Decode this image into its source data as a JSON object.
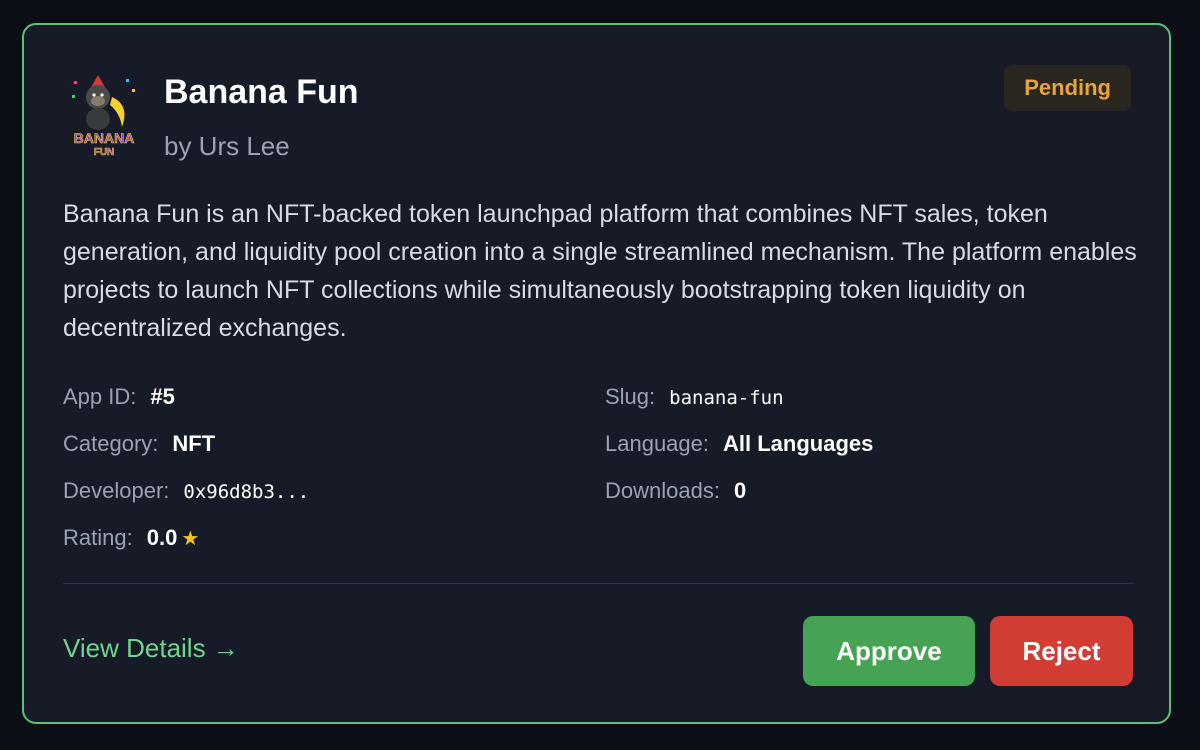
{
  "app": {
    "title": "Banana Fun",
    "author": "by Urs Lee",
    "logo_icon": "banana-gorilla-logo",
    "logo_text_top": "BANANA",
    "logo_text_bottom": "FUN",
    "status": "Pending",
    "description": "Banana Fun is an NFT-backed token launchpad platform that combines NFT sales, token generation, and liquidity pool creation into a single streamlined mechanism. The platform enables projects to launch NFT collections while simultaneously bootstrapping token liquidity on decentralized exchanges."
  },
  "fields": {
    "app_id": {
      "label": "App ID:",
      "value": "#5"
    },
    "slug": {
      "label": "Slug:",
      "value": "banana-fun"
    },
    "category": {
      "label": "Category:",
      "value": "NFT"
    },
    "language": {
      "label": "Language:",
      "value": "All Languages"
    },
    "developer": {
      "label": "Developer:",
      "value": "0x96d8b3..."
    },
    "downloads": {
      "label": "Downloads:",
      "value": "0"
    },
    "rating": {
      "label": "Rating:",
      "value": "0.0",
      "icon": "star-icon"
    }
  },
  "actions": {
    "view_details": "View Details →",
    "approve": "Approve",
    "reject": "Reject"
  },
  "colors": {
    "accent_green": "#5fbf7a",
    "pending": "#e8a53c",
    "approve": "#46a353",
    "reject": "#d13c34"
  }
}
